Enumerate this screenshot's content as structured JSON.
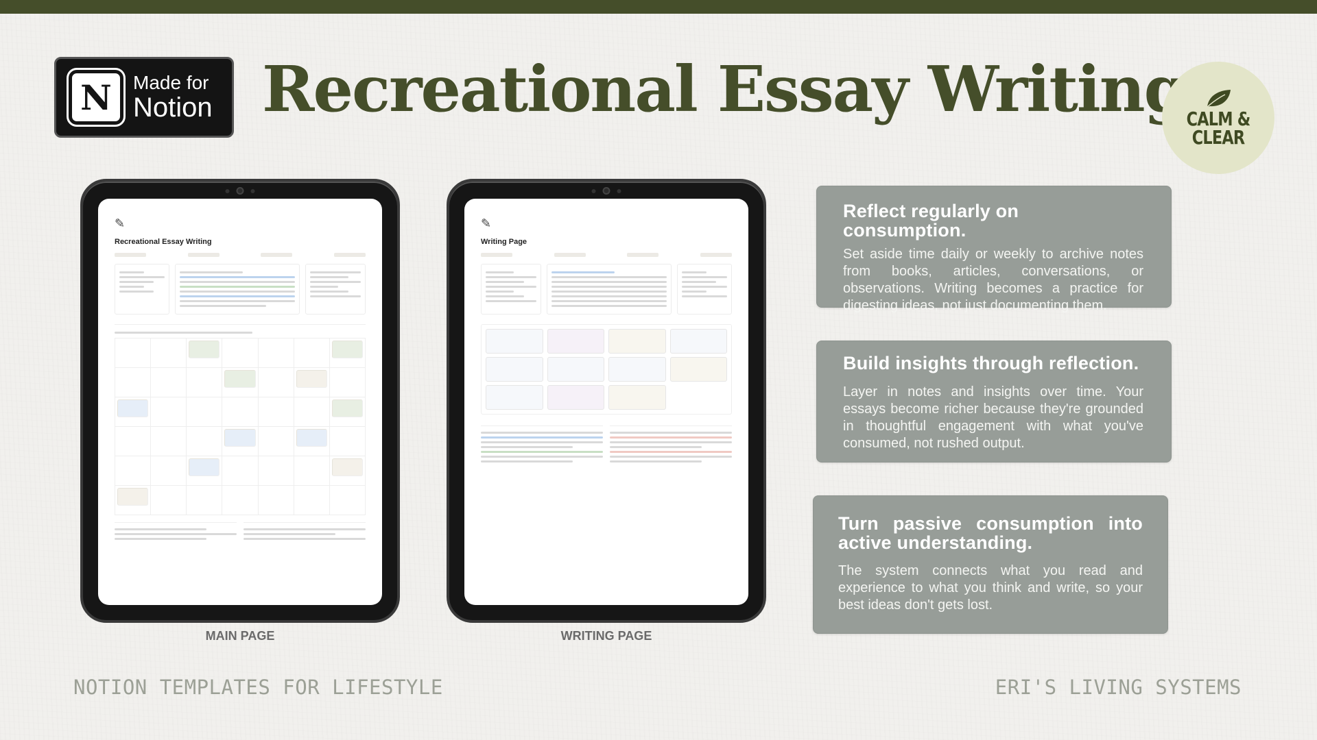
{
  "badge": {
    "line1": "Made for",
    "line2": "Notion",
    "logo_letter": "N"
  },
  "title": "Recreational Essay Writing",
  "seal": {
    "line1": "CALM &",
    "line2": "CLEAR",
    "icon": "leaf-icon",
    "color": "#e3e5c9"
  },
  "tablets": [
    {
      "screen_title": "Recreational Essay Writing",
      "caption": "MAIN PAGE"
    },
    {
      "screen_title": "Writing Page",
      "caption": "WRITING PAGE"
    }
  ],
  "cards": [
    {
      "heading": "Reflect regularly on consumption.",
      "body": "Set aside time daily or weekly to archive notes from books, articles, conversations, or observations. Writing becomes a practice for digesting ideas, not just documenting them."
    },
    {
      "heading": "Build insights through reflection.",
      "body": "Layer in notes and insights over time. Your essays become richer because they're grounded in thoughtful engagement with what you've consumed, not rushed output."
    },
    {
      "heading": "Turn passive consumption into active understanding.",
      "body": "The system connects what you read and experience to what you think and write, so your best ideas don't gets lost."
    }
  ],
  "footer": {
    "left": "NOTION TEMPLATES FOR LIFESTYLE",
    "right": "ERI'S LIVING SYSTEMS"
  },
  "colors": {
    "brand_dark": "#454e2a",
    "card_bg": "#979d98",
    "background": "#f1f0ed"
  }
}
